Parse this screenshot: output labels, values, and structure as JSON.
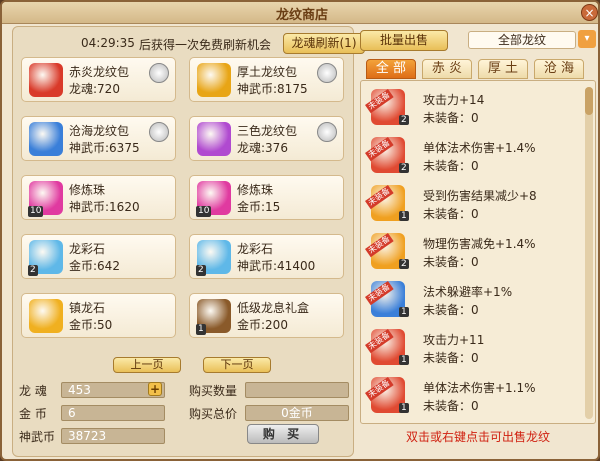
{
  "window": {
    "title": "龙纹商店",
    "close_icon": "×"
  },
  "shop": {
    "timer": "04:29:35",
    "timer_note": "后获得一次免费刷新机会",
    "refresh_label": "龙魂刷新(1)",
    "items": [
      {
        "name": "赤炎龙纹包",
        "price": "龙魂:720",
        "icon_color": "#d93a2a",
        "badge": true,
        "icon": "red-pouch-icon"
      },
      {
        "name": "厚土龙纹包",
        "price": "神武币:8175",
        "icon_color": "#e8a516",
        "badge": true,
        "icon": "yellow-pouch-icon"
      },
      {
        "name": "沧海龙纹包",
        "price": "神武币:6375",
        "icon_color": "#3a7fd9",
        "badge": true,
        "icon": "blue-pouch-icon"
      },
      {
        "name": "三色龙纹包",
        "price": "龙魂:376",
        "icon_color": "#b04ad0",
        "badge": true,
        "icon": "purple-pouch-icon"
      },
      {
        "name": "修炼珠",
        "price": "神武币:1620",
        "icon_color": "#e03aa0",
        "count": "10",
        "icon": "pearl-icon"
      },
      {
        "name": "修炼珠",
        "price": "金币:15",
        "icon_color": "#e03aa0",
        "count": "10",
        "icon": "pearl-icon"
      },
      {
        "name": "龙彩石",
        "price": "金币:642",
        "icon_color": "#5fb8e8",
        "count": "2",
        "icon": "dragon-stone-icon"
      },
      {
        "name": "龙彩石",
        "price": "神武币:41400",
        "icon_color": "#5fb8e8",
        "count": "2",
        "icon": "dragon-stone-icon"
      },
      {
        "name": "镇龙石",
        "price": "金币:50",
        "icon_color": "#f0b020",
        "icon": "gold-stone-icon"
      },
      {
        "name": "低级龙息礼盒",
        "price": "金币:200",
        "icon_color": "#8a5a2a",
        "count": "1",
        "icon": "chest-icon"
      }
    ],
    "prev_label": "上一页",
    "next_label": "下一页"
  },
  "currency": {
    "longhun_label": "龙 魂",
    "longhun": "453",
    "gold_label": "金 币",
    "gold": "6",
    "shenwu_label": "神武币",
    "shenwu": "38723",
    "qty_label": "购买数量",
    "qty": "",
    "total_label": "购买总价",
    "total": "0金币",
    "buy_label": "购 买",
    "plus_icon": "+"
  },
  "sell": {
    "bulk_label": "批量出售",
    "filter_value": "全部龙纹",
    "filter_arrow": "▾",
    "tabs": [
      {
        "label": "全 部",
        "active": true
      },
      {
        "label": "赤 炎"
      },
      {
        "label": "厚 土"
      },
      {
        "label": "沧 海"
      }
    ],
    "equip_tag": "未装备",
    "rows": [
      {
        "name": "攻击力+14",
        "status": "未装备：0",
        "lvl": "2",
        "color": "#e04a32"
      },
      {
        "name": "单体法术伤害+1.4%",
        "status": "未装备：0",
        "lvl": "2",
        "color": "#e04a32"
      },
      {
        "name": "受到伤害结果减少+8",
        "status": "未装备：0",
        "lvl": "1",
        "color": "#f0a020"
      },
      {
        "name": "物理伤害减免+1.4%",
        "status": "未装备：0",
        "lvl": "2",
        "color": "#f0a020"
      },
      {
        "name": "法术躲避率+1%",
        "status": "未装备：0",
        "lvl": "1",
        "color": "#3a7fd9"
      },
      {
        "name": "攻击力+11",
        "status": "未装备：0",
        "lvl": "1",
        "color": "#e04a32"
      },
      {
        "name": "单体法术伤害+1.1%",
        "status": "未装备：0",
        "lvl": "1",
        "color": "#e04a32"
      }
    ],
    "hint": "双击或右键点击可出售龙纹"
  }
}
